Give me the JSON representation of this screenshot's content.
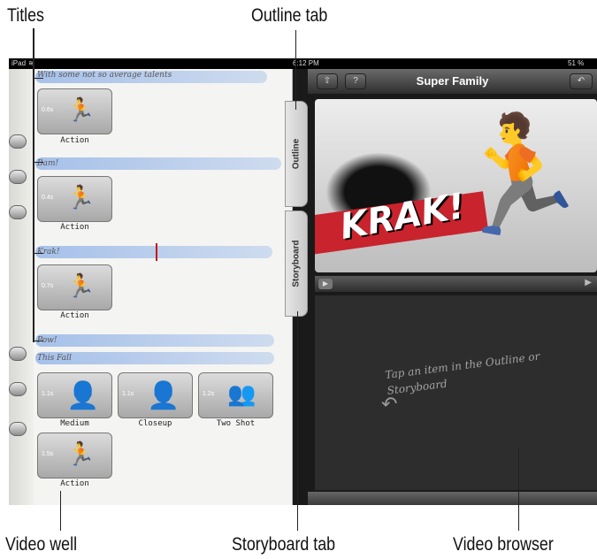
{
  "callouts": {
    "titles": "Titles",
    "outline_tab": "Outline tab",
    "video_well": "Video well",
    "storyboard_tab": "Storyboard tab",
    "video_browser": "Video browser"
  },
  "status": {
    "device": "iPad",
    "time": "6:12 PM",
    "battery": "51 %"
  },
  "header": {
    "title": "Super Family"
  },
  "tabs": {
    "outline": "Outline",
    "storyboard": "Storyboard"
  },
  "titles": [
    "With some not so average talents",
    "Bam!",
    "Krak!",
    "Pow!",
    "This Fall"
  ],
  "clips": [
    {
      "duration": "0.6s",
      "label": "Action"
    },
    {
      "duration": "0.4s",
      "label": "Action"
    },
    {
      "duration": "0.7s",
      "label": "Action"
    },
    {
      "duration": "1.1s",
      "label": "Medium"
    },
    {
      "duration": "1.1s",
      "label": "Closeup"
    },
    {
      "duration": "1.2s",
      "label": "Two Shot"
    },
    {
      "duration": "1.5s",
      "label": "Action"
    }
  ],
  "preview": {
    "overlay_text": "KRAK!"
  },
  "browser": {
    "hint": "Tap an item in the Outline or Storyboard"
  },
  "icons": {
    "runner": "runner-icon",
    "play": "play-icon",
    "undo": "undo-icon",
    "help": "help-icon"
  }
}
